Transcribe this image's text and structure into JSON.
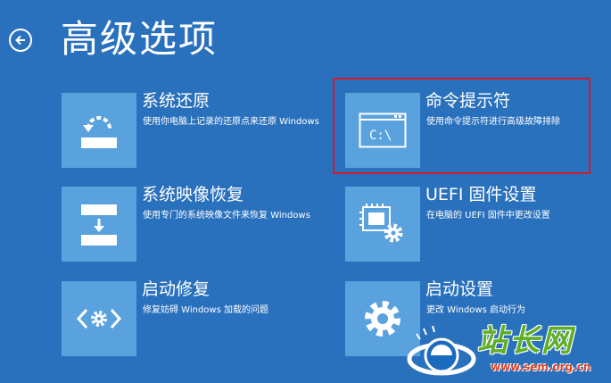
{
  "page": {
    "title": "高级选项",
    "back_icon": "back-arrow-icon"
  },
  "options": [
    {
      "title": "系统还原",
      "description": "使用你电脑上记录的还原点来还原 Windows",
      "icon": "system-restore-icon"
    },
    {
      "title": "命令提示符",
      "description": "使用命令提示符进行高级故障排除",
      "icon": "command-prompt-icon",
      "highlighted": true
    },
    {
      "title": "系统映像恢复",
      "description": "使用专门的系统映像文件来恢复 Windows",
      "icon": "system-image-recovery-icon"
    },
    {
      "title": "UEFI 固件设置",
      "description": "在电脑的 UEFI 固件中更改设置",
      "icon": "uefi-firmware-icon"
    },
    {
      "title": "启动修复",
      "description": "修复妨碍 Windows 加载的问题",
      "icon": "startup-repair-icon"
    },
    {
      "title": "启动设置",
      "description": "更改 Windows 启动行为",
      "icon": "startup-settings-icon"
    }
  ],
  "cmd_icon_text": "C:\\",
  "watermark": {
    "text": "站长网",
    "url": "www.sem.org.cn"
  },
  "colors": {
    "background": "#2a71bd",
    "tile": "#5aa2de",
    "highlight": "#d21b2c"
  }
}
